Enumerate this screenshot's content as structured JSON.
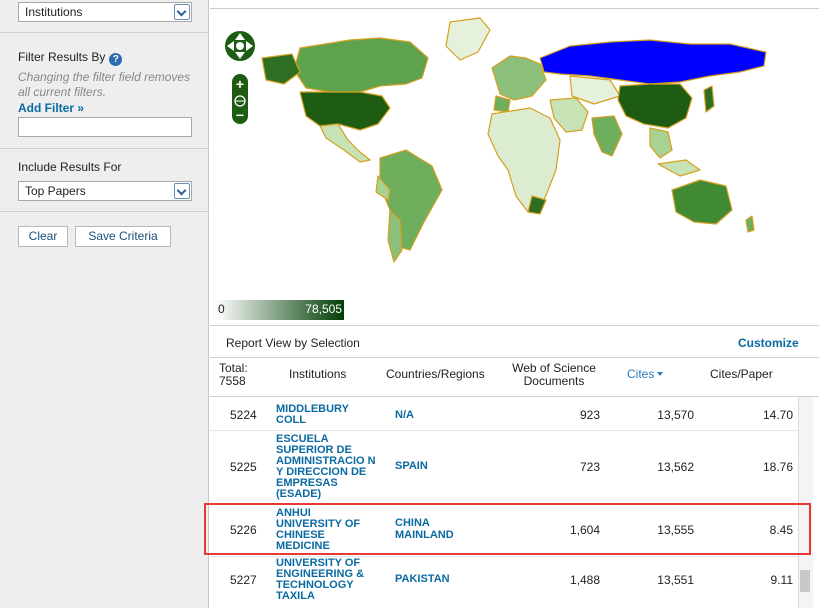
{
  "sidebar": {
    "group_select": "Institutions",
    "filter_title": "Filter Results By",
    "filter_hint": "Changing the filter field removes all current filters.",
    "add_filter": "Add Filter »",
    "include_title": "Include Results For",
    "include_select": "Top Papers",
    "clear_label": "Clear",
    "save_label": "Save Criteria"
  },
  "map": {
    "legend_min": "0",
    "legend_max": "78,505",
    "colors": {
      "high": "#1e5c14",
      "mid": "#5da34d",
      "low": "#c7e2b5",
      "selected": "#0000ff",
      "border": "#d4a020"
    }
  },
  "report": {
    "title": "Report View by Selection",
    "customize": "Customize",
    "headers": {
      "total": "Total:",
      "total_count": "7558",
      "institutions": "Institutions",
      "countries": "Countries/Regions",
      "wos_docs": "Web of Science Documents",
      "cites": "Cites",
      "cites_per_paper": "Cites/Paper"
    },
    "rows": [
      {
        "rank": "5224",
        "institution": "MIDDLEBURY COLL",
        "country": "N/A",
        "docs": "923",
        "cites": "13,570",
        "cpp": "14.70"
      },
      {
        "rank": "5225",
        "institution": "ESCUELA SUPERIOR DE ADMINISTRACIO N Y DIRECCION DE EMPRESAS (ESADE)",
        "country": "SPAIN",
        "docs": "723",
        "cites": "13,562",
        "cpp": "18.76"
      },
      {
        "rank": "5226",
        "institution": "ANHUI UNIVERSITY OF CHINESE MEDICINE",
        "country": "CHINA MAINLAND",
        "docs": "1,604",
        "cites": "13,555",
        "cpp": "8.45"
      },
      {
        "rank": "5227",
        "institution": "UNIVERSITY OF ENGINEERING & TECHNOLOGY TAXILA",
        "country": "PAKISTAN",
        "docs": "1,488",
        "cites": "13,551",
        "cpp": "9.11"
      }
    ]
  }
}
